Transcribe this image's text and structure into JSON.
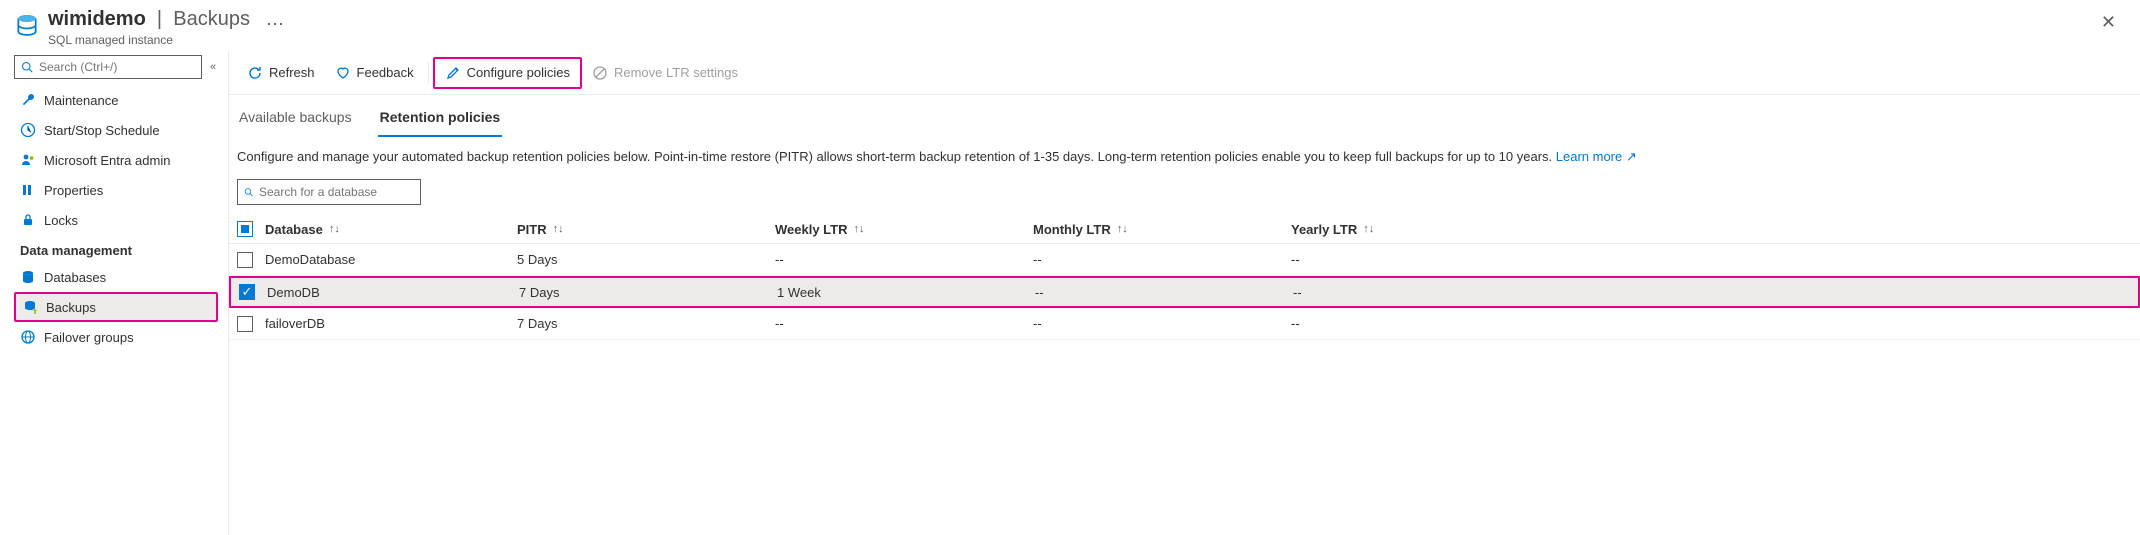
{
  "header": {
    "instance_name": "wimidemo",
    "section": "Backups",
    "subtitle": "SQL managed instance"
  },
  "sidebar": {
    "search_placeholder": "Search (Ctrl+/)",
    "items": [
      {
        "label": "Maintenance",
        "icon": "wrench"
      },
      {
        "label": "Start/Stop Schedule",
        "icon": "clock"
      },
      {
        "label": "Microsoft Entra admin",
        "icon": "person"
      },
      {
        "label": "Properties",
        "icon": "properties"
      },
      {
        "label": "Locks",
        "icon": "lock"
      }
    ],
    "section2_title": "Data management",
    "items2": [
      {
        "label": "Databases",
        "icon": "database",
        "selected": false
      },
      {
        "label": "Backups",
        "icon": "backup",
        "selected": true
      },
      {
        "label": "Failover groups",
        "icon": "globe",
        "selected": false
      }
    ]
  },
  "toolbar": {
    "refresh_label": "Refresh",
    "feedback_label": "Feedback",
    "configure_label": "Configure policies",
    "remove_label": "Remove LTR settings"
  },
  "tabs": [
    {
      "label": "Available backups",
      "active": false
    },
    {
      "label": "Retention policies",
      "active": true
    }
  ],
  "info_text": "Configure and manage your automated backup retention policies below. Point-in-time restore (PITR) allows short-term backup retention of 1-35 days. Long-term retention policies enable you to keep full backups for up to 10 years. ",
  "info_link": "Learn more",
  "db_search_placeholder": "Search for a database",
  "columns": {
    "db": "Database",
    "pitr": "PITR",
    "weekly": "Weekly LTR",
    "monthly": "Monthly LTR",
    "yearly": "Yearly LTR"
  },
  "rows": [
    {
      "name": "DemoDatabase",
      "pitr": "5 Days",
      "weekly": "--",
      "monthly": "--",
      "yearly": "--",
      "checked": false,
      "selected": false
    },
    {
      "name": "DemoDB",
      "pitr": "7 Days",
      "weekly": "1 Week",
      "monthly": "--",
      "yearly": "--",
      "checked": true,
      "selected": true
    },
    {
      "name": "failoverDB",
      "pitr": "7 Days",
      "weekly": "--",
      "monthly": "--",
      "yearly": "--",
      "checked": false,
      "selected": false
    }
  ]
}
